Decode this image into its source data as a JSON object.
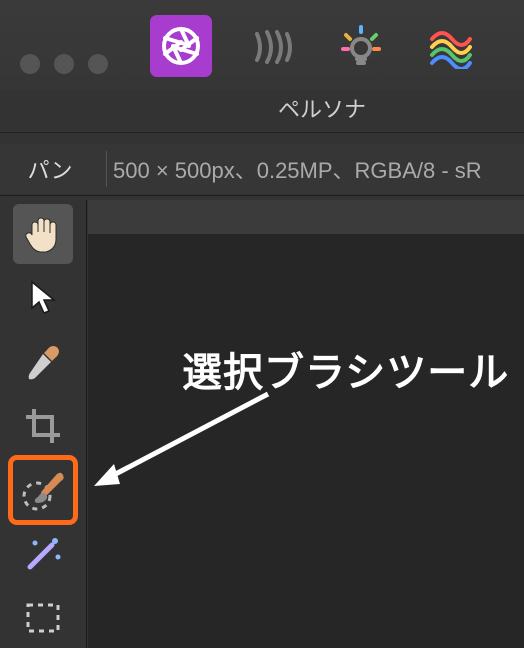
{
  "persona_section_label": "ペルソナ",
  "persona_buttons": [
    {
      "name": "photo-persona",
      "active": true
    },
    {
      "name": "liquify-persona",
      "active": false
    },
    {
      "name": "develop-persona",
      "active": false
    },
    {
      "name": "tone-map-persona",
      "active": false
    }
  ],
  "context": {
    "tool_label": "パン",
    "info": "500 × 500px、0.25MP、RGBA/8 - sR"
  },
  "tools": [
    {
      "name": "hand-tool",
      "selected": true,
      "highlight": false
    },
    {
      "name": "move-tool",
      "selected": false,
      "highlight": false
    },
    {
      "name": "color-picker-tool",
      "selected": false,
      "highlight": false
    },
    {
      "name": "crop-tool",
      "selected": false,
      "highlight": false
    },
    {
      "name": "selection-brush-tool",
      "selected": false,
      "highlight": true
    },
    {
      "name": "smart-selection-tool",
      "selected": false,
      "highlight": false
    },
    {
      "name": "marquee-tool",
      "selected": false,
      "highlight": false
    }
  ],
  "annotation": {
    "label": "選択ブラシツール"
  },
  "colors": {
    "accent": "#a83ccf",
    "highlight": "#ff6a1a"
  }
}
